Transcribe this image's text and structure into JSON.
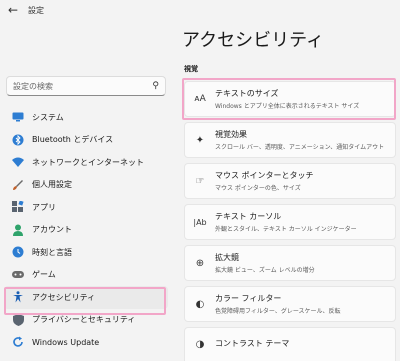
{
  "titlebar": {
    "back_icon": "back-arrow-icon",
    "label": "設定"
  },
  "search": {
    "placeholder": "設定の検索"
  },
  "sidebar": {
    "items": [
      {
        "label": "システム",
        "icon": "system-icon",
        "color": "#2d7dd2"
      },
      {
        "label": "Bluetooth とデバイス",
        "icon": "bluetooth-icon",
        "color": "#2d7dd2"
      },
      {
        "label": "ネットワークとインターネット",
        "icon": "network-icon",
        "color": "#2d7dd2"
      },
      {
        "label": "個人用設定",
        "icon": "brush-icon",
        "color": "#c0602a"
      },
      {
        "label": "アプリ",
        "icon": "apps-icon",
        "color": "#5a6470"
      },
      {
        "label": "アカウント",
        "icon": "account-icon",
        "color": "#2fa36b"
      },
      {
        "label": "時刻と言語",
        "icon": "time-language-icon",
        "color": "#2d7dd2"
      },
      {
        "label": "ゲーム",
        "icon": "gaming-icon",
        "color": "#6b6b6b"
      },
      {
        "label": "アクセシビリティ",
        "icon": "accessibility-icon",
        "color": "#1a5fb4",
        "active": true
      },
      {
        "label": "プライバシーとセキュリティ",
        "icon": "shield-icon",
        "color": "#5a6470"
      },
      {
        "label": "Windows Update",
        "icon": "update-icon",
        "color": "#2d7dd2"
      }
    ]
  },
  "main": {
    "title": "アクセシビリティ",
    "section": "視覚",
    "cards": [
      {
        "title": "テキストのサイズ",
        "subtitle": "Windows とアプリ全体に表示されるテキスト サイズ",
        "icon": "text-size-icon"
      },
      {
        "title": "視覚効果",
        "subtitle": "スクロール バー、透明度、アニメーション、通知タイムアウト",
        "icon": "visual-effects-icon"
      },
      {
        "title": "マウス ポインターとタッチ",
        "subtitle": "マウス ポインターの色、サイズ",
        "icon": "mouse-pointer-icon"
      },
      {
        "title": "テキスト カーソル",
        "subtitle": "外観とスタイル、テキスト カーソル インジケーター",
        "icon": "text-cursor-icon"
      },
      {
        "title": "拡大鏡",
        "subtitle": "拡大鏡 ビュー、ズーム レベルの増分",
        "icon": "magnifier-icon"
      },
      {
        "title": "カラー フィルター",
        "subtitle": "色覚障碍用フィルター、グレースケール、反転",
        "icon": "color-filter-icon"
      },
      {
        "title": "コントラスト テーマ",
        "subtitle": "",
        "icon": "contrast-theme-icon"
      }
    ]
  },
  "colors": {
    "accent": "#0067c0",
    "highlight": "#f2a6c8"
  }
}
